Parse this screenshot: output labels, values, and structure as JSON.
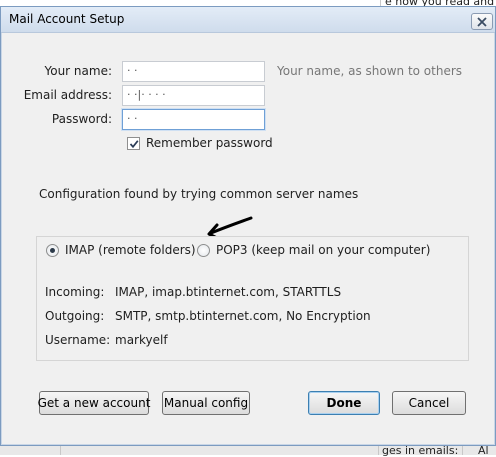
{
  "background": {
    "top_right_text": "e how you read and",
    "bottom_left_text": "ges in emails:",
    "bottom_right_text": "Al"
  },
  "dialog": {
    "title": "Mail Account Setup",
    "close_icon": "close-icon"
  },
  "form": {
    "name_label": "Your name:",
    "name_value": "·  ·",
    "name_hint": "Your name, as shown to others",
    "email_label": "Email address:",
    "email_value": "·  ·|· ·  ·  ·",
    "password_label": "Password:",
    "password_value": "·   ·",
    "remember_label": "Remember password",
    "remember_checked": true
  },
  "status": "Configuration found by trying common server names",
  "protocols": {
    "imap_label": "IMAP (remote folders)",
    "pop3_label": "POP3 (keep mail on your computer)",
    "selected": "imap"
  },
  "server_info": {
    "incoming_label": "Incoming:",
    "incoming_value": "IMAP, imap.btinternet.com, STARTTLS",
    "outgoing_label": "Outgoing:",
    "outgoing_value": "SMTP, smtp.btinternet.com, No Encryption",
    "username_label": "Username:",
    "username_value": "markyelf"
  },
  "buttons": {
    "new_account": "Get a new account",
    "manual_config": "Manual config",
    "done": "Done",
    "cancel": "Cancel"
  },
  "colors": {
    "titlebar": "#cfdcec",
    "dialog_bg": "#f0f0f0",
    "default_button_border": "#3c7fb1"
  }
}
